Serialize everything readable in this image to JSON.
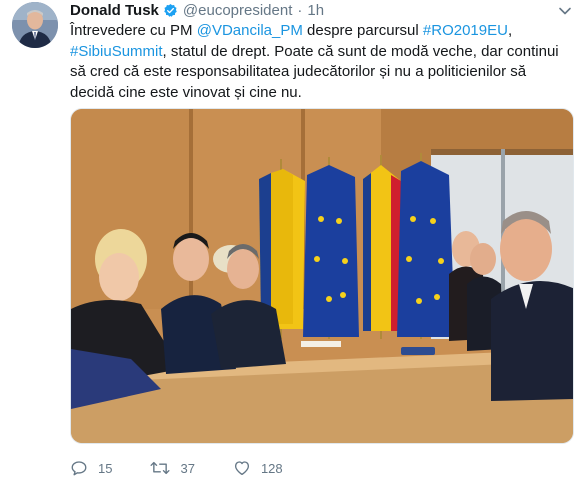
{
  "tweet": {
    "author_name": "Donald Tusk",
    "handle": "@eucopresident",
    "separator": "·",
    "time": "1h",
    "text_plain_1": "Întrevedere cu PM ",
    "mention": "@VDancila_PM",
    "text_plain_2": " despre parcursul ",
    "hashtag_1": "#RO2019EU",
    "text_plain_3": ", ",
    "hashtag_2": "#SibiuSummit",
    "text_plain_4": ", statul de drept. Poate că sunt de modă veche, dar continui să cred că este responsabilitatea judecătorilor și nu a politicienilor să decidă cine este vinovat și cine nu.",
    "verified": true
  },
  "actions": {
    "reply_count": "15",
    "retweet_count": "37",
    "like_count": "128"
  },
  "colors": {
    "link": "#1b95e0",
    "secondary_text": "#657786",
    "verified": "#1da1f2"
  },
  "icons": {
    "reply": "reply-icon",
    "retweet": "retweet-icon",
    "like": "heart-icon",
    "menu": "chevron-down-icon",
    "verified": "verified-badge-icon"
  }
}
